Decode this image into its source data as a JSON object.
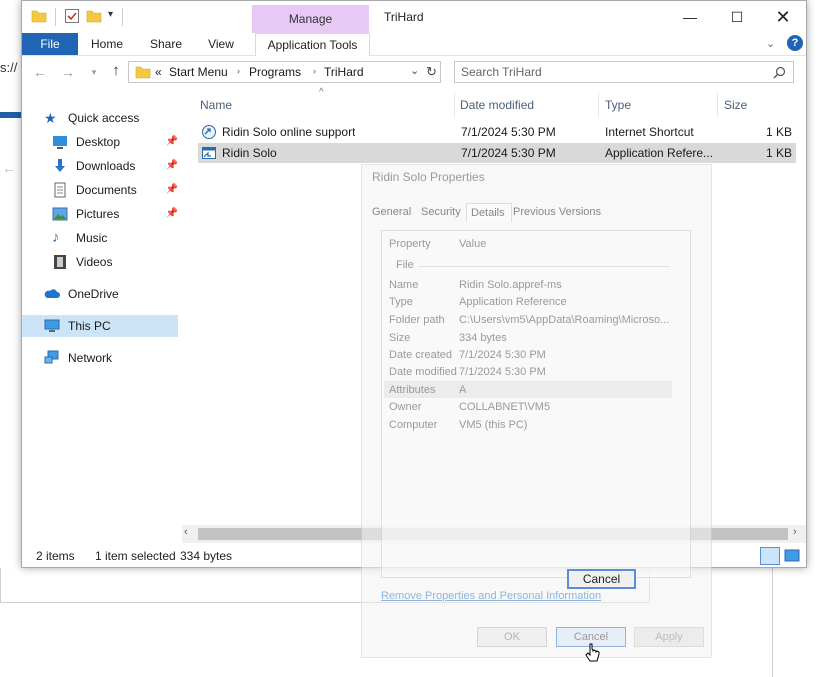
{
  "window": {
    "title": "TriHard",
    "manage_label": "Manage",
    "app_tools_label": "Application Tools"
  },
  "ribbon": {
    "tabs": [
      "File",
      "Home",
      "Share",
      "View"
    ]
  },
  "address": {
    "prefix": "«",
    "crumbs": [
      "Start Menu",
      "Programs",
      "TriHard"
    ],
    "search_placeholder": "Search TriHard"
  },
  "sidebar": {
    "quick_access": "Quick access",
    "items": [
      "Desktop",
      "Downloads",
      "Documents",
      "Pictures",
      "Music",
      "Videos"
    ],
    "onedrive": "OneDrive",
    "this_pc": "This PC",
    "network": "Network"
  },
  "columns": [
    "Name",
    "Date modified",
    "Type",
    "Size"
  ],
  "files": [
    {
      "name": "Ridin Solo online support",
      "date": "7/1/2024 5:30 PM",
      "type": "Internet Shortcut",
      "size": "1 KB"
    },
    {
      "name": "Ridin Solo",
      "date": "7/1/2024 5:30 PM",
      "type": "Application Refere...",
      "size": "1 KB"
    }
  ],
  "status": {
    "items": "2 items",
    "selected": "1 item selected",
    "bytes": "334 bytes"
  },
  "properties": {
    "title": "Ridin Solo Properties",
    "tabs": [
      "General",
      "Security",
      "Details",
      "Previous Versions"
    ],
    "header_property": "Property",
    "header_value": "Value",
    "section": "File",
    "rows": [
      {
        "label": "Name",
        "value": "Ridin Solo.appref-ms"
      },
      {
        "label": "Type",
        "value": "Application Reference"
      },
      {
        "label": "Folder path",
        "value": "C:\\Users\\vm5\\AppData\\Roaming\\Microso..."
      },
      {
        "label": "Size",
        "value": "334 bytes"
      },
      {
        "label": "Date created",
        "value": "7/1/2024 5:30 PM"
      },
      {
        "label": "Date modified",
        "value": "7/1/2024 5:30 PM"
      },
      {
        "label": "Attributes",
        "value": "A"
      },
      {
        "label": "Owner",
        "value": "COLLABNET\\VM5"
      },
      {
        "label": "Computer",
        "value": "VM5 (this PC)"
      }
    ],
    "remove_link": "Remove Properties and Personal Information",
    "cancel_inner": "Cancel",
    "ok": "OK",
    "cancel": "Cancel",
    "apply": "Apply"
  },
  "background": {
    "partial_text": "s://"
  },
  "colors": {
    "file_tab": "#1f64b5",
    "manage_tab": "#e8c8f4",
    "selection": "#cce4f7",
    "help": "#1f64b5"
  }
}
